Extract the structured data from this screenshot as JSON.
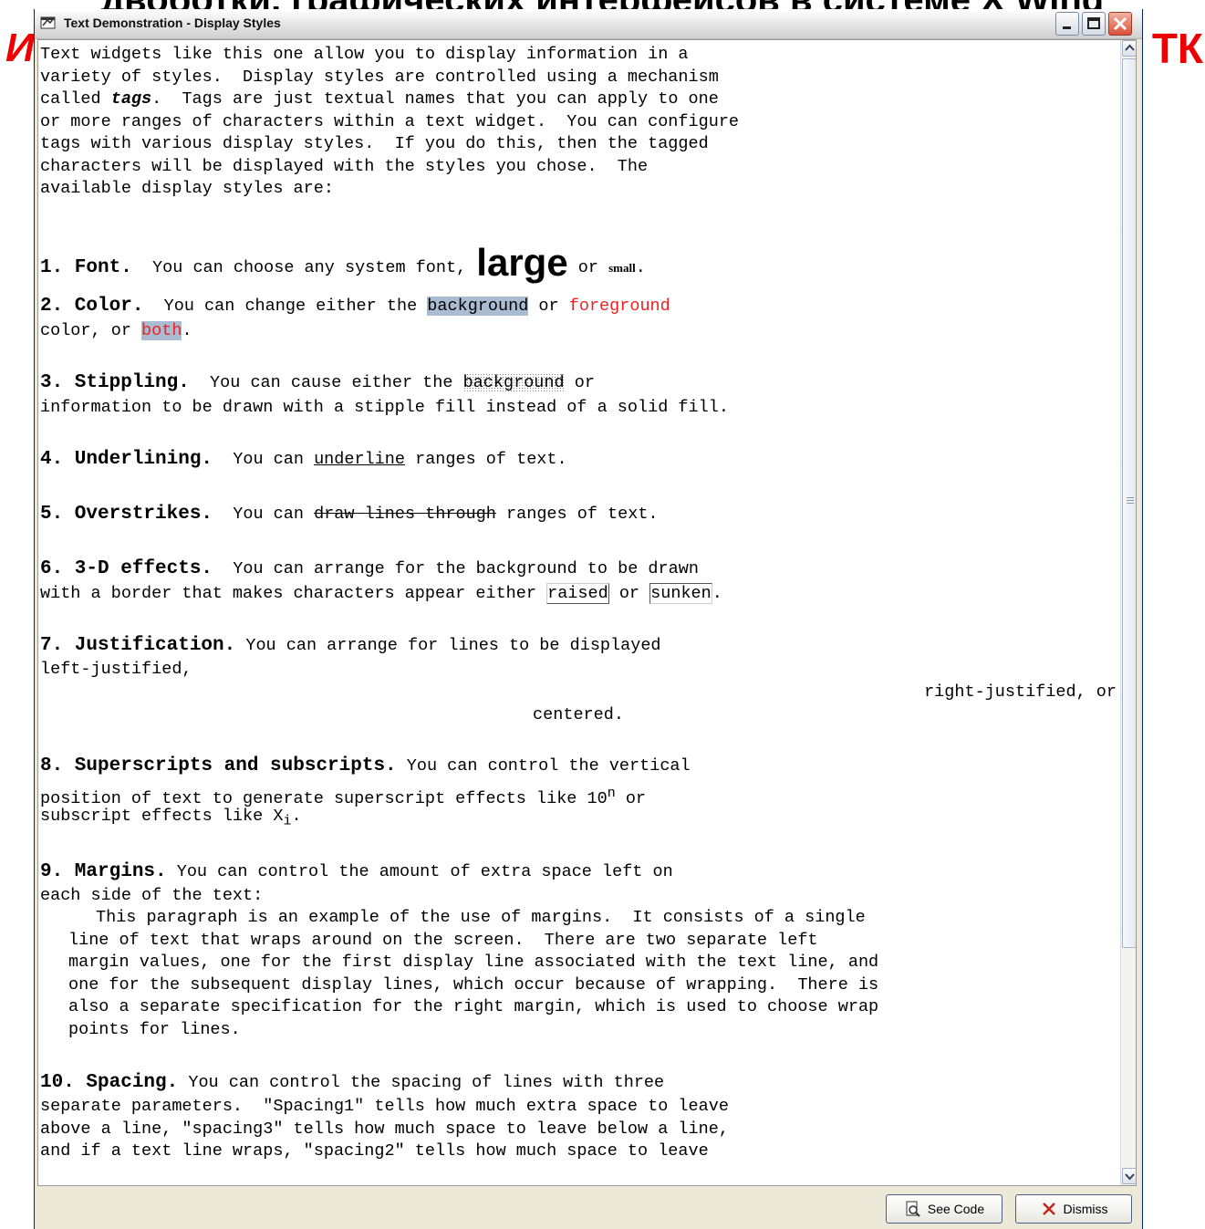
{
  "background": {
    "heading_text": "двоботки, графических интерфейсов в системе X Wind",
    "left_text": "И",
    "right_text": "ТК"
  },
  "window": {
    "title": "Text Demonstration - Display Styles",
    "controls": [
      "minimize",
      "maximize",
      "close"
    ]
  },
  "intro": [
    "Text widgets like this one allow you to display information in a",
    "variety of styles.  Display styles are controlled using a mechanism",
    "called ",
    "tags",
    ".  Tags are just textual names that you can apply to one",
    "or more ranges of characters within a text widget.  You can configure",
    "tags with various display styles.  If you do this, then the tagged",
    "characters will be displayed with the styles you chose.  The",
    "available display styles are:"
  ],
  "sections": {
    "font": {
      "h": "1. Font.",
      "a": "  You can choose any system font, ",
      "large": "large",
      "b": " or ",
      "small": "small",
      "c": "."
    },
    "color": {
      "h": "2. Color.",
      "a": "  You can change either the ",
      "bg": "background",
      "b": " or ",
      "fg": "foreground",
      "l2a": "color, or ",
      "both": "both",
      "l2b": "."
    },
    "stipple": {
      "h": "3. Stippling.",
      "a": "  You can cause either the ",
      "bg": "background",
      "b": " or ",
      "l2": "information to be drawn with a stipple fill instead of a solid fill."
    },
    "underline": {
      "h": "4. Underlining.",
      "a": "  You can ",
      "u": "underline",
      "b": " ranges of text."
    },
    "overstrike": {
      "h": "5. Overstrikes.",
      "a": "  You can ",
      "s": "draw lines through",
      "b": " ranges of text."
    },
    "effects": {
      "h": "6. 3-D effects.",
      "a": "  You can arrange for the background to be drawn",
      "l2a": "with a border that makes characters appear either ",
      "raised": "raised",
      "l2b": " or ",
      "sunken": "sunken",
      "l2c": "."
    },
    "justify": {
      "h": "7. Justification.",
      "a": " You can arrange for lines to be displayed",
      "left": "left-justified,",
      "right": "right-justified, or",
      "center": "centered."
    },
    "super": {
      "h": "8. Superscripts and subscripts.",
      "a": " You can control the vertical",
      "l2a": "position of text to generate superscript effects like 10",
      "sup": "n",
      "l2b": " or",
      "l3a": "subscript effects like X",
      "sub": "i",
      "l3b": "."
    },
    "margins": {
      "h": "9. Margins.",
      "a": " You can control the amount of extra space left on",
      "l2": "each side of the text:",
      "para": [
        "This paragraph is an example of the use of margins.  It consists of a single",
        "line of text that wraps around on the screen.  There are two separate left",
        "margin values, one for the first display line associated with the text line, and",
        "one for the subsequent display lines, which occur because of wrapping.  There is",
        "also a separate specification for the right margin, which is used to choose wrap",
        "points for lines."
      ]
    },
    "spacing": {
      "h": "10. Spacing.",
      "a": " You can control the spacing of lines with three",
      "lines": [
        "separate parameters.  \"Spacing1\" tells how much extra space to leave",
        "above a line, \"spacing3\" tells how much space to leave below a line,",
        "and if a text line wraps, \"spacing2\" tells how much space to leave"
      ]
    }
  },
  "buttons": {
    "see_code": "See Code",
    "dismiss": "Dismiss"
  }
}
